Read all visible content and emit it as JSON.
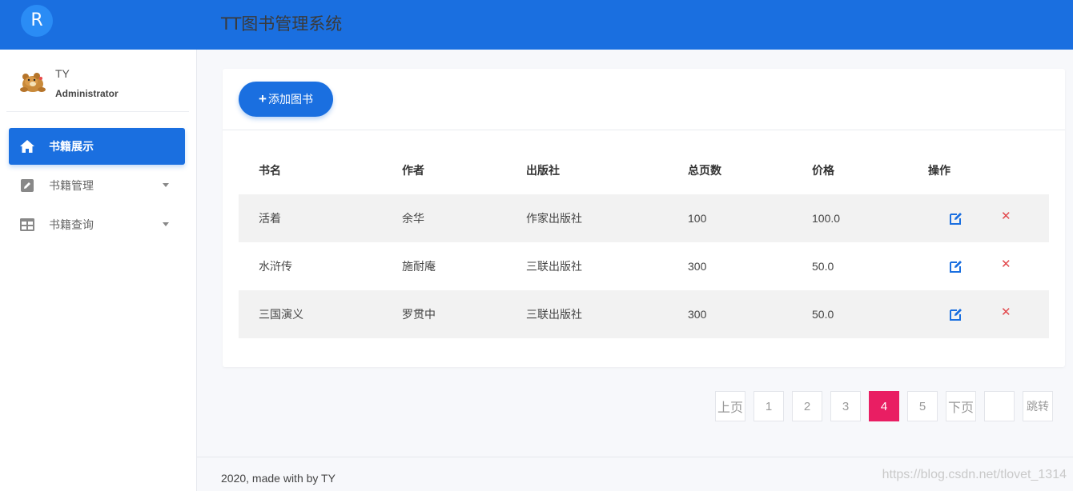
{
  "header": {
    "logo_letter": "R",
    "title": "TT图书管理系统"
  },
  "user": {
    "name": "TY",
    "role": "Administrator",
    "avatar_icon": "bear-avatar-icon"
  },
  "sidebar": {
    "items": [
      {
        "label": "书籍展示",
        "icon": "home-icon",
        "active": true
      },
      {
        "label": "书籍管理",
        "icon": "edit-icon",
        "active": false
      },
      {
        "label": "书籍查询",
        "icon": "table-icon",
        "active": false
      }
    ]
  },
  "toolbar": {
    "add_label": "添加图书"
  },
  "table": {
    "columns": [
      "书名",
      "作者",
      "出版社",
      "总页数",
      "价格",
      "操作"
    ],
    "rows": [
      {
        "name": "活着",
        "author": "余华",
        "publisher": "作家出版社",
        "pages": "100",
        "price": "100.0"
      },
      {
        "name": "水浒传",
        "author": "施耐庵",
        "publisher": "三联出版社",
        "pages": "300",
        "price": "50.0"
      },
      {
        "name": "三国演义",
        "author": "罗贯中",
        "publisher": "三联出版社",
        "pages": "300",
        "price": "50.0"
      }
    ]
  },
  "pagination": {
    "prev": "上页",
    "pages": [
      "1",
      "2",
      "3",
      "4",
      "5"
    ],
    "current": "4",
    "next": "下页",
    "jump_value": "",
    "jump": "跳转"
  },
  "footer": {
    "text": "2020, made with by TY",
    "watermark": "https://blog.csdn.net/tlovet_1314"
  },
  "colors": {
    "primary": "#1a6fe0",
    "active_page": "#e91e63",
    "delete": "#e2474b"
  }
}
